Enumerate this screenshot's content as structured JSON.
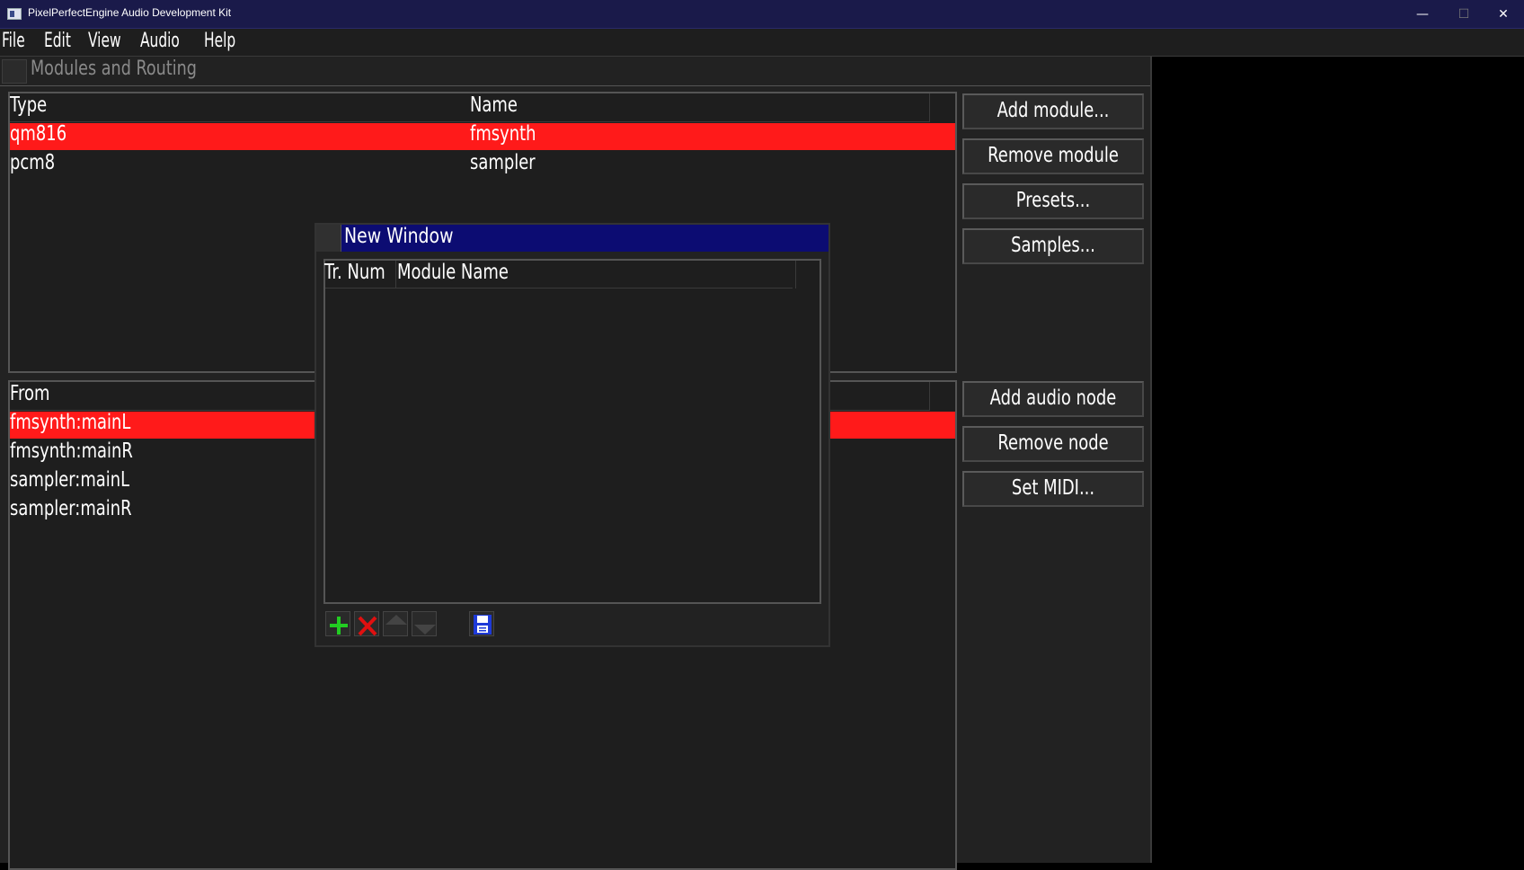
{
  "os_window": {
    "title": "PixelPerfectEngine Audio Development Kit",
    "minimize": "—",
    "maximize": "☐",
    "close": "✕"
  },
  "menubar": {
    "items": [
      "File",
      "Edit",
      "View",
      "Audio",
      "Help"
    ]
  },
  "main_window": {
    "title": "Modules and Routing"
  },
  "modules_table": {
    "columns": [
      "Type",
      "Name"
    ],
    "rows": [
      {
        "type": "qm816",
        "name": "fmsynth",
        "selected": true
      },
      {
        "type": "pcm8",
        "name": "sampler",
        "selected": false
      }
    ]
  },
  "module_buttons": {
    "add": "Add module...",
    "remove": "Remove module",
    "presets": "Presets...",
    "samples": "Samples..."
  },
  "routing_table": {
    "columns": [
      "From"
    ],
    "rows": [
      {
        "from": "fmsynth:mainL",
        "selected": true
      },
      {
        "from": "fmsynth:mainR",
        "selected": false
      },
      {
        "from": "sampler:mainL",
        "selected": false
      },
      {
        "from": "sampler:mainR",
        "selected": false
      }
    ]
  },
  "routing_buttons": {
    "add": "Add audio node",
    "remove": "Remove node",
    "midi": "Set MIDI..."
  },
  "dialog": {
    "title": "New Window",
    "columns": [
      "Tr. Num",
      "Module Name"
    ],
    "toolbar": [
      "add-icon",
      "delete-icon",
      "move-up-icon",
      "move-down-icon",
      "save-icon"
    ]
  },
  "colors": {
    "selection": "#ff1a1a",
    "dialog_titlebar": "#0c0c72",
    "panel_bg": "#1e1e1e",
    "client_bg": "#222222"
  }
}
